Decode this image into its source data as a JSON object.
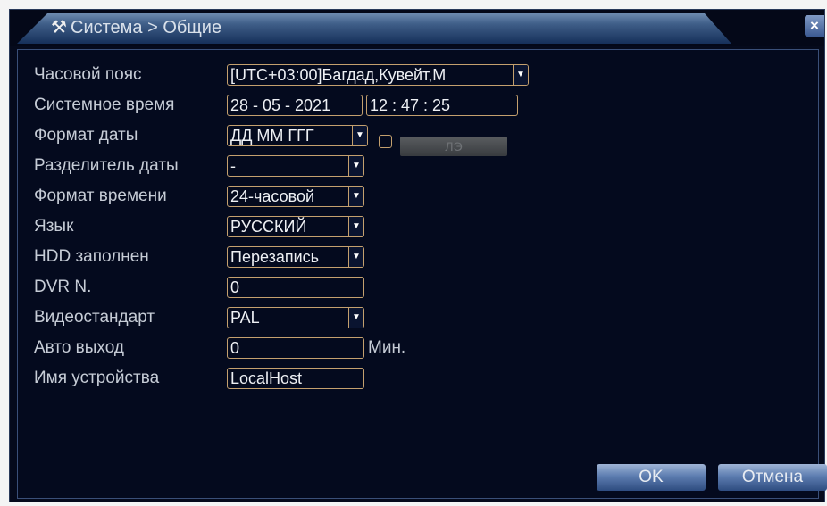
{
  "window": {
    "title": "Система > Общие",
    "title_icon": "tools-icon",
    "close_label": "×"
  },
  "settings": [
    {
      "label": "Часовой пояс",
      "value": "[UTC+03:00]Багдад,Кувейт,М",
      "type": "dropdown"
    },
    {
      "label": "Системное время",
      "date": "28 - 05 - 2021",
      "time": "12 : 47 : 25",
      "type": "datetime"
    },
    {
      "label": "Формат даты",
      "value": "ДД ММ ГГГ",
      "type": "dropdown"
    },
    {
      "label": "Разделитель даты",
      "value": "-",
      "type": "dropdown"
    },
    {
      "label": "Формат времени",
      "value": "24-часовой",
      "type": "dropdown"
    },
    {
      "label": "Язык",
      "value": "РУССКИЙ",
      "type": "dropdown"
    },
    {
      "label": "HDD заполнен",
      "value": "Перезапись",
      "type": "dropdown"
    },
    {
      "label": "DVR N.",
      "value": "0",
      "type": "input"
    },
    {
      "label": "Видеостандарт",
      "value": "PAL",
      "type": "dropdown"
    },
    {
      "label": "Авто выход",
      "value": "0",
      "type": "input",
      "suffix": "Мин."
    },
    {
      "label": "Имя устройства",
      "value": "LocalHost",
      "type": "input"
    }
  ],
  "date_format_extra": {
    "button_label": "ЛЭ",
    "checkbox_checked": false
  },
  "buttons": {
    "ok": "OK",
    "cancel": "Отмена"
  },
  "colors": {
    "field_border": "#c4a06e",
    "button_blue": "#5d7db0",
    "background": "#040a1e"
  }
}
